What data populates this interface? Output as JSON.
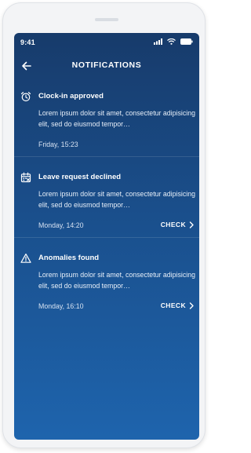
{
  "status": {
    "time": "9:41",
    "icons": [
      "signal-icon",
      "wifi-icon",
      "battery-icon"
    ]
  },
  "header": {
    "title": "NOTIFICATIONS",
    "back_icon": "arrow-left-icon"
  },
  "notifications": [
    {
      "icon": "alarm-clock-icon",
      "title": "Clock-in approved",
      "body": "Lorem ipsum dolor sit amet, consectetur adipisicing elit, sed do eiusmod tempor…",
      "time": "Friday, 15:23",
      "action": ""
    },
    {
      "icon": "calendar-icon",
      "title": "Leave request declined",
      "body": "Lorem ipsum dolor sit amet, consectetur adipisicing elit, sed do eiusmod tempor…",
      "time": "Monday, 14:20",
      "action": "CHECK"
    },
    {
      "icon": "warning-icon",
      "title": "Anomalies found",
      "body": "Lorem ipsum dolor sit amet, consectetur adipisicing elit, sed do eiusmod tempor…",
      "time": "Monday, 16:10",
      "action": "CHECK"
    }
  ],
  "colors": {
    "screen_top": "#173b6b",
    "screen_bottom": "#1e64ad",
    "text": "#ffffff"
  }
}
